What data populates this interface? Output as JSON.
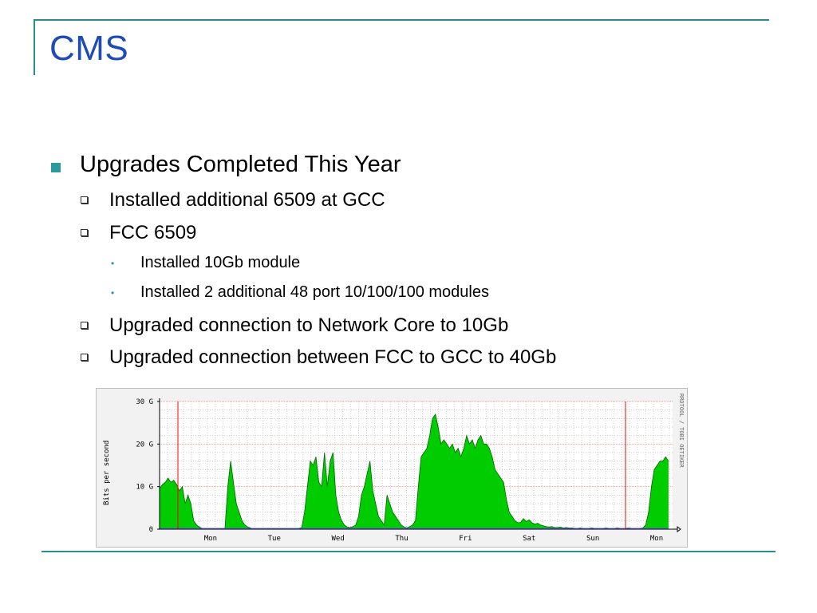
{
  "slide": {
    "title": "CMS",
    "bullets": {
      "level1": "Upgrades Completed This Year",
      "level2_a": "Installed additional 6509 at GCC",
      "level2_b": "FCC 6509",
      "level3_a": "Installed 10Gb module",
      "level3_b": "Installed 2 additional 48 port 10/100/100 modules",
      "level2_c": "Upgraded connection to Network Core to 10Gb",
      "level2_d": "Upgraded connection between FCC to GCC to 40Gb"
    }
  },
  "graph": {
    "ylabel": "Bits per second",
    "side_label": "RRDTOOL / TOBI OETIKER",
    "y_ticks": [
      "30 G",
      "20 G",
      "10 G",
      "0"
    ],
    "x_labels": [
      "Mon",
      "Tue",
      "Wed",
      "Thu",
      "Fri",
      "Sat",
      "Sun",
      "Mon"
    ],
    "fill_color": "#00cc00",
    "outline_color": "#006600",
    "marker_color": "#ff0000",
    "ymax_gbps": 30,
    "series_gbps": [
      9.5,
      10.5,
      11,
      12,
      11,
      11.5,
      10.5,
      9,
      10,
      6,
      8,
      6,
      2,
      1,
      0.5,
      0.2,
      0,
      0,
      0,
      0,
      0,
      0,
      0,
      0.3,
      10,
      16,
      11,
      6,
      4,
      2,
      1,
      0.5,
      0.3,
      0,
      0,
      0,
      0,
      0,
      0,
      0,
      0,
      0,
      0,
      0,
      0,
      0,
      0,
      0,
      0,
      0.2,
      0.4,
      4,
      10,
      16,
      15,
      17,
      11,
      10,
      18,
      10,
      16,
      18,
      8,
      4,
      2,
      1,
      0.5,
      0.4,
      0.6,
      1,
      3,
      8,
      10,
      13,
      16,
      9,
      6,
      3,
      2,
      1,
      8,
      6,
      4,
      3,
      2,
      1,
      0.5,
      0.3,
      0.6,
      1,
      2,
      10,
      17,
      18,
      19,
      22,
      26,
      27,
      24,
      20,
      21,
      20,
      19,
      20,
      18,
      19,
      17,
      19,
      22,
      20,
      21,
      19,
      21,
      22,
      20,
      20,
      19,
      17,
      14,
      13,
      12,
      11,
      7,
      4,
      3,
      2,
      1.5,
      1.6,
      2.5,
      1.8,
      2.2,
      1.5,
      1.2,
      1.4,
      1,
      0.8,
      0.6,
      0.5,
      0.6,
      0.4,
      0.4,
      0.5,
      0.3,
      0.4,
      0.3,
      0.3,
      0.2,
      0.2,
      0.3,
      0.2,
      0.2,
      0.2,
      0.3,
      0.2,
      0.2,
      0.2,
      0.2,
      0.3,
      0.2,
      0.2,
      0.2,
      0.3,
      0.2,
      0.2,
      0.2,
      0.3,
      0.2,
      0.2,
      0.2,
      0.2,
      0.3,
      1,
      4,
      10,
      14,
      15,
      16,
      16,
      17,
      16
    ]
  }
}
